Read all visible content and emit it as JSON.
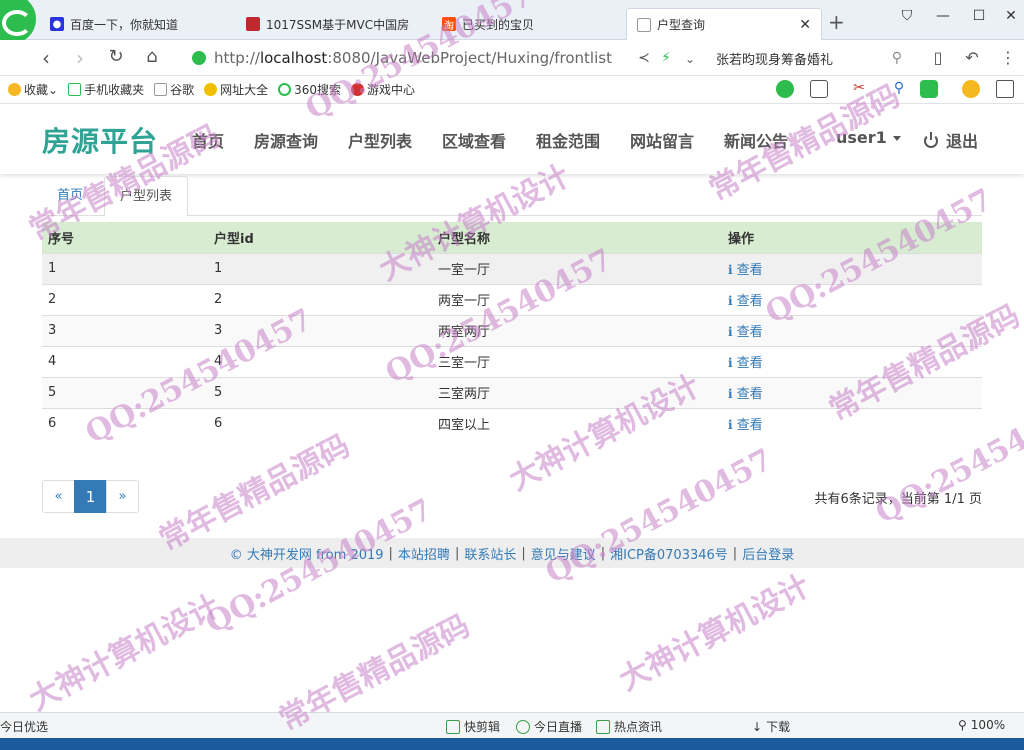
{
  "browser": {
    "tabs": [
      {
        "title": "百度一下，你就知道",
        "favicon_color": "#2932e1"
      },
      {
        "title": "1017SSM基于MVC中国房",
        "favicon_color": "#c0282f"
      },
      {
        "title": "已买到的宝贝",
        "favicon_color": "#ff5000"
      },
      {
        "title": "户型查询",
        "favicon_color": "#999999"
      }
    ],
    "url_prefix": "http://",
    "url_host": "localhost",
    "url_rest": ":8080/JavaWebProject/Huxing/frontlist",
    "search_text": "张若昀现身筹备婚礼",
    "bookmarks": [
      "收藏",
      "手机收藏夹",
      "谷歌",
      "网址大全",
      "360搜索",
      "游戏中心"
    ]
  },
  "site": {
    "brand": "房源平台",
    "nav": [
      "首页",
      "房源查询",
      "户型列表",
      "区域查看",
      "租金范围",
      "网站留言",
      "新闻公告"
    ],
    "user": "user1",
    "logout": "退出"
  },
  "breadcrumb": {
    "home": "首页",
    "current": "户型列表"
  },
  "table": {
    "headers": [
      "序号",
      "户型id",
      "户型名称",
      "操作"
    ],
    "action_label": "查看",
    "rows": [
      {
        "no": "1",
        "id": "1",
        "name": "一室一厅"
      },
      {
        "no": "2",
        "id": "2",
        "name": "两室一厅"
      },
      {
        "no": "3",
        "id": "3",
        "name": "两室两厅"
      },
      {
        "no": "4",
        "id": "4",
        "name": "三室一厅"
      },
      {
        "no": "5",
        "id": "5",
        "name": "三室两厅"
      },
      {
        "no": "6",
        "id": "6",
        "name": "四室以上"
      }
    ]
  },
  "pagination": {
    "prev": "«",
    "page": "1",
    "next": "»",
    "summary": "共有6条记录，当前第 1/1 页"
  },
  "footer": {
    "links": [
      "© 大神开发网 from 2019",
      "本站招聘",
      "联系站长",
      "意见与建议",
      "湘ICP备0703346号",
      "后台登录"
    ]
  },
  "statusbar": {
    "left": "今日优选",
    "items": [
      "快剪辑",
      "今日直播",
      "热点资讯",
      "下载"
    ],
    "zoom": "100%"
  },
  "colors": {
    "brand": "#2fa495",
    "link": "#337ab7",
    "header_row": "#d8ecd2"
  }
}
